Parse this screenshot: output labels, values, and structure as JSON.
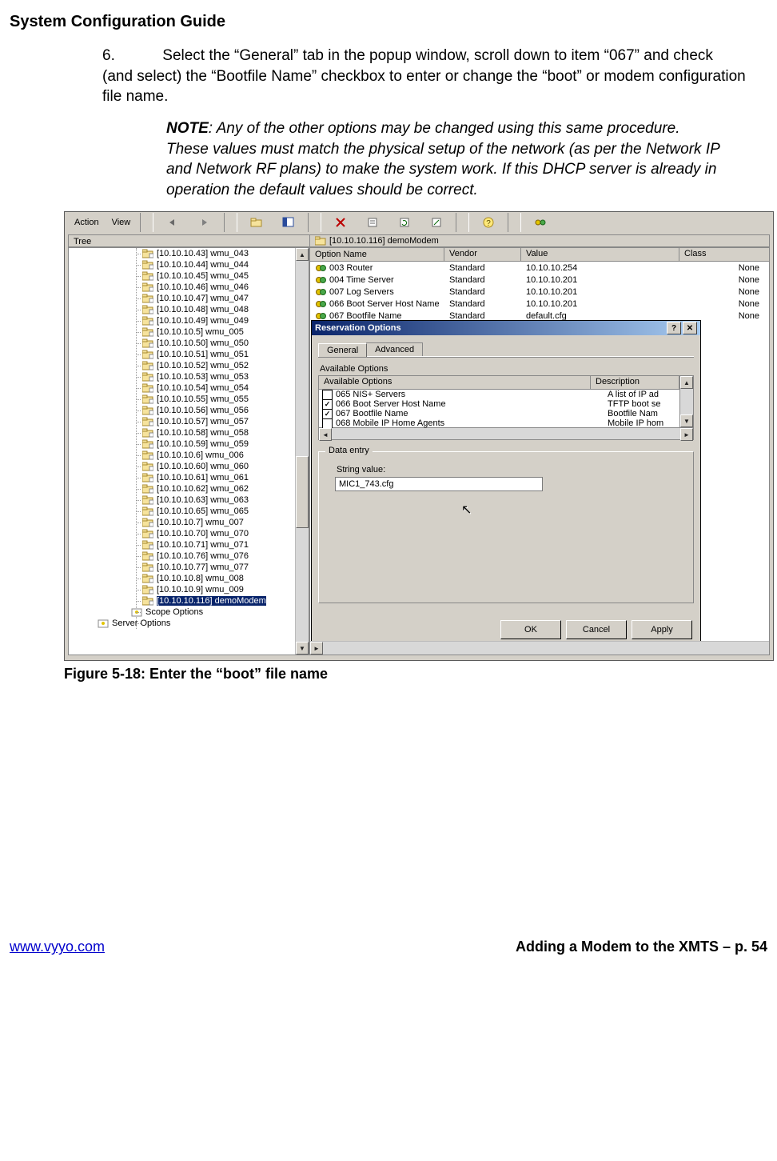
{
  "doc": {
    "header": "System Configuration Guide",
    "step_num": "6.",
    "step_text": "Select the “General” tab in the popup window, scroll down to item “067” and check (and select) the “Bootfile Name” checkbox to enter or change the “boot” or modem configuration file name.",
    "note_label": "NOTE",
    "note_text": ": Any of the other options may be changed using this same procedure.  These values must match the physical setup of the network (as per the Network IP and Network RF plans) to make the system work.  If this DHCP server is already in operation the default values should be correct.",
    "figure_caption": "Figure 5-18: Enter the “boot” file name",
    "footer_left": "www.vyyo.com",
    "footer_right": "Adding a Modem to the XMTS – p. 54"
  },
  "mmc": {
    "menu": {
      "action": "Action",
      "view": "View"
    },
    "tree_label": "Tree",
    "breadcrumb": "[10.10.10.116] demoModem",
    "tree": [
      "[10.10.10.43] wmu_043",
      "[10.10.10.44] wmu_044",
      "[10.10.10.45] wmu_045",
      "[10.10.10.46] wmu_046",
      "[10.10.10.47] wmu_047",
      "[10.10.10.48] wmu_048",
      "[10.10.10.49] wmu_049",
      "[10.10.10.5] wmu_005",
      "[10.10.10.50] wmu_050",
      "[10.10.10.51] wmu_051",
      "[10.10.10.52] wmu_052",
      "[10.10.10.53] wmu_053",
      "[10.10.10.54] wmu_054",
      "[10.10.10.55] wmu_055",
      "[10.10.10.56] wmu_056",
      "[10.10.10.57] wmu_057",
      "[10.10.10.58] wmu_058",
      "[10.10.10.59] wmu_059",
      "[10.10.10.6] wmu_006",
      "[10.10.10.60] wmu_060",
      "[10.10.10.61] wmu_061",
      "[10.10.10.62] wmu_062",
      "[10.10.10.63] wmu_063",
      "[10.10.10.65] wmu_065",
      "[10.10.10.7] wmu_007",
      "[10.10.10.70] wmu_070",
      "[10.10.10.71] wmu_071",
      "[10.10.10.76] wmu_076",
      "[10.10.10.77] wmu_077",
      "[10.10.10.8] wmu_008",
      "[10.10.10.9] wmu_009",
      "[10.10.10.116] demoModem"
    ],
    "tree_after": [
      "Scope Options"
    ],
    "tree_footer": [
      "Server Options"
    ],
    "columns": {
      "c0": "Option Name",
      "c1": "Vendor",
      "c2": "Value",
      "c3": "Class"
    },
    "rows": [
      {
        "name": "003 Router",
        "vendor": "Standard",
        "value": "10.10.10.254",
        "klass": "None"
      },
      {
        "name": "004 Time Server",
        "vendor": "Standard",
        "value": "10.10.10.201",
        "klass": "None"
      },
      {
        "name": "007 Log Servers",
        "vendor": "Standard",
        "value": "10.10.10.201",
        "klass": "None"
      },
      {
        "name": "066 Boot Server Host Name",
        "vendor": "Standard",
        "value": "10.10.10.201",
        "klass": "None"
      },
      {
        "name": "067 Bootfile Name",
        "vendor": "Standard",
        "value": "default.cfg",
        "klass": "None"
      }
    ]
  },
  "dialog": {
    "title": "Reservation Options",
    "tab_general": "General",
    "tab_advanced": "Advanced",
    "available_label": "Available Options",
    "desc_header": "Description",
    "options": [
      {
        "checked": false,
        "label": "065 NIS+ Servers",
        "desc": "A list of IP ad"
      },
      {
        "checked": true,
        "label": "066 Boot Server Host Name",
        "desc": "TFTP boot se"
      },
      {
        "checked": true,
        "label": "067 Bootfile Name",
        "desc": "Bootfile Nam"
      },
      {
        "checked": false,
        "label": "068 Mobile IP Home Agents",
        "desc": "Mobile IP hom"
      }
    ],
    "data_entry_legend": "Data entry",
    "string_label": "String value:",
    "string_value": "MIC1_743.cfg",
    "ok": "OK",
    "cancel": "Cancel",
    "apply": "Apply",
    "help_btn": "?",
    "close_btn": "✕"
  }
}
